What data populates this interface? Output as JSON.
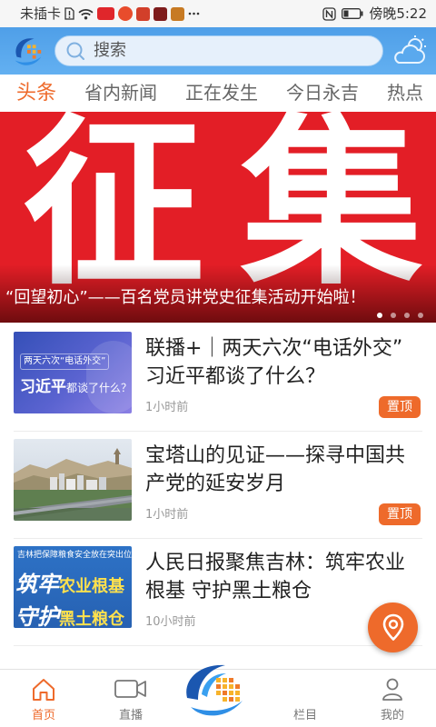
{
  "status_bar": {
    "carrier": "未插卡",
    "time": "傍晚5:22",
    "battery_level": 0.3,
    "left_icons": [
      "sim-alert-icon",
      "wifi-icon",
      "app-notification-icon",
      "app-notification-icon",
      "app-notification-icon",
      "app-notification-icon",
      "app-notification-icon",
      "more-notifications-icon"
    ],
    "right_icons": [
      "nfc-icon",
      "battery-icon"
    ]
  },
  "header": {
    "logo_icon": "app-logo-icon",
    "search_icon": "search-icon",
    "search_placeholder": "搜索",
    "weather_icon": "weather-cloud-sun-icon"
  },
  "tabs": [
    {
      "label": "头条",
      "active": true
    },
    {
      "label": "省内新闻",
      "active": false
    },
    {
      "label": "正在发生",
      "active": false
    },
    {
      "label": "今日永吉",
      "active": false
    },
    {
      "label": "热点",
      "active": false
    }
  ],
  "banner": {
    "headline_chars": [
      "征",
      "集"
    ],
    "caption": "“回望初心”——百名党员讲党史征集活动开始啦！",
    "slides_total": 4,
    "active_slide_index": 0
  },
  "news": [
    {
      "title_lines": [
        "联播+｜两天六次“电话外交”",
        "习近平都谈了什么？"
      ],
      "time": "1小时前",
      "badge": "置顶",
      "thumb": {
        "line1": "两天六次“电话外交”",
        "name": "习近平",
        "line2": "都谈了什么？"
      }
    },
    {
      "title_lines": [
        "宝塔山的见证——探寻中国共",
        "产党的延安岁月"
      ],
      "time": "1小时前",
      "badge": "置顶"
    },
    {
      "title_lines": [
        "人民日报聚焦吉林：筑牢农业",
        "根基 守护黑土粮仓"
      ],
      "time": "10小时前",
      "thumb": {
        "caption": "吉林把保障粮食安全放在突出位置",
        "line1_a": "筑牢",
        "line1_b": "农业根基",
        "line2_a": "守护",
        "line2_b": "黑土粮仓"
      }
    }
  ],
  "floating_button": {
    "icon": "location-pin-icon"
  },
  "bottom_nav": {
    "items": [
      {
        "label": "首页",
        "icon": "home-icon",
        "active": true
      },
      {
        "label": "直播",
        "icon": "video-camera-icon",
        "active": false
      },
      {
        "label": "栏目",
        "active": false
      },
      {
        "label": "我的",
        "icon": "person-icon",
        "active": false
      }
    ],
    "center_icon": "app-logo-icon"
  },
  "colors": {
    "accent": "#ee6a2b",
    "header_blue": "#4f9fe8",
    "banner_red": "#e31e26",
    "thumb_yellow": "#ffe14d"
  }
}
